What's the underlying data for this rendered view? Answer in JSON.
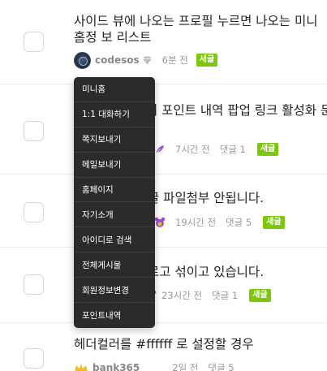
{
  "posts": [
    {
      "title": "사이드 뷰에 나오는 프로필 누르면 나오는 미니홈정 보 리스트",
      "author": "codesos",
      "time": "6분 전",
      "comments": "",
      "badge": "새글"
    },
    {
      "title": "서 포인트 내역 팝업 링크 활성화 문",
      "author": "",
      "time": "7시간 전",
      "comments": "댓글 1",
      "badge": "새글"
    },
    {
      "title": "글 파일첨부 안됩니다.",
      "author": "",
      "time": "19시간 전",
      "comments": "댓글 5",
      "badge": "새글"
    },
    {
      "title": "로고 섞이고 있습니다.",
      "author": "",
      "time": "23시간 전",
      "comments": "댓글 1",
      "badge": "새글"
    },
    {
      "title": "헤더컬러를 #ffffff 로 설정할 경우",
      "author": "bank365",
      "time": "2일 전",
      "comments": "댓글 5",
      "badge": ""
    }
  ],
  "profile_menu": {
    "items": [
      "미니홈",
      "1:1 대화하기",
      "쪽지보내기",
      "메일보내기",
      "홈페이지",
      "자기소개",
      "아이디로 검색",
      "전체게시물",
      "회원정보변경",
      "포인트내역"
    ]
  },
  "colors": {
    "badge_new": "#7bc70a",
    "menu_bg": "#2b2b2b",
    "icon_purple": "#9b4fd6",
    "icon_gold": "#f0c020"
  }
}
